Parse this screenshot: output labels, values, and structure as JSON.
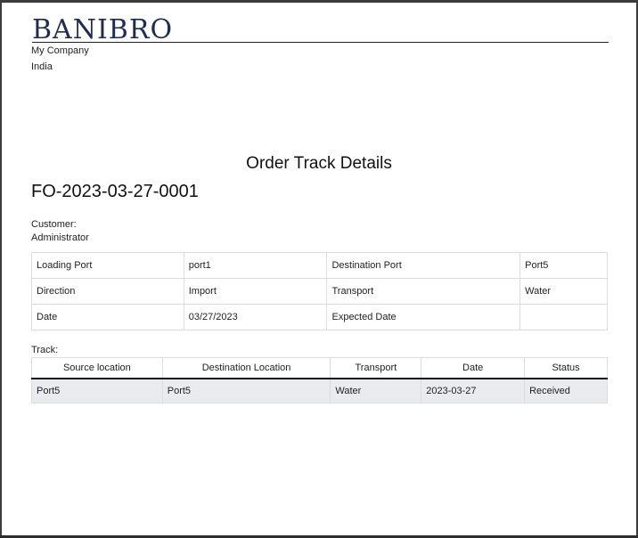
{
  "header": {
    "logo_text": "BANIBRO",
    "company_name": "My Company",
    "company_country": "India"
  },
  "document": {
    "title": "Order Track Details",
    "order_number": "FO-2023-03-27-0001",
    "customer_label": "Customer:",
    "customer_name": "Administrator"
  },
  "info": {
    "rows": [
      {
        "label1": "Loading Port",
        "value1": "port1",
        "label2": "Destination Port",
        "value2": "Port5"
      },
      {
        "label1": "Direction",
        "value1": "Import",
        "label2": "Transport",
        "value2": "Water"
      },
      {
        "label1": "Date",
        "value1": "03/27/2023",
        "label2": "Expected Date",
        "value2": ""
      }
    ]
  },
  "track": {
    "label": "Track:",
    "columns": [
      "Source location",
      "Destination Location",
      "Transport",
      "Date",
      "Status"
    ],
    "rows": [
      [
        "Port5",
        "Port5",
        "Water",
        "2023-03-27",
        "Received"
      ]
    ]
  }
}
